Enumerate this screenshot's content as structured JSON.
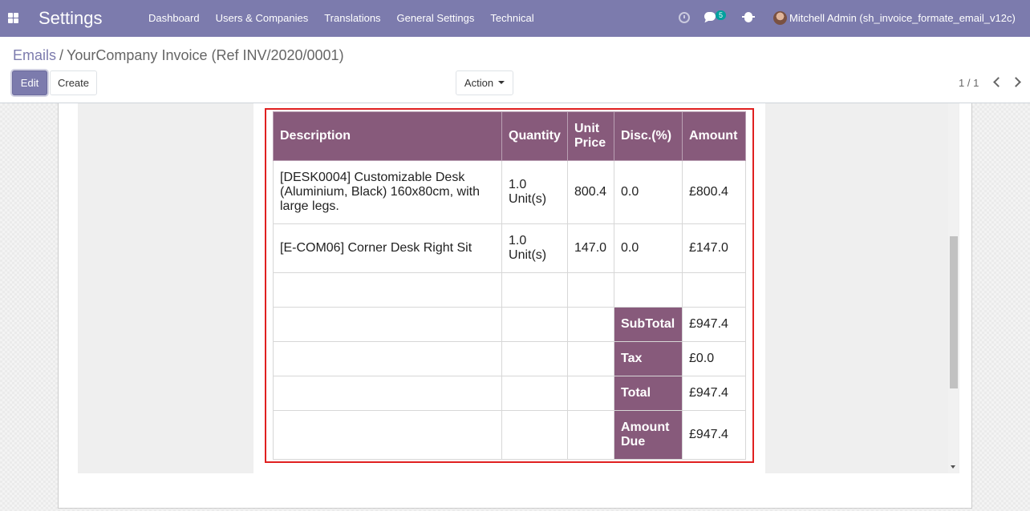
{
  "navbar": {
    "app_title": "Settings",
    "menu": [
      "Dashboard",
      "Users & Companies",
      "Translations",
      "General Settings",
      "Technical"
    ],
    "messages_count": "5",
    "user": "Mitchell Admin (sh_invoice_formate_email_v12c)",
    "color": "#7c7bad"
  },
  "breadcrumb": {
    "parent": "Emails",
    "separator": "/",
    "current": "YourCompany Invoice (Ref INV/2020/0001)"
  },
  "buttons": {
    "edit": "Edit",
    "create": "Create",
    "action": "Action"
  },
  "pager": {
    "value": "1 / 1"
  },
  "invoice": {
    "accent_color": "#875a7b",
    "highlight_color": "#e02020",
    "headers": {
      "description": "Description",
      "quantity": "Quantity",
      "unit_price": "Unit Price",
      "discount": "Disc.(%)",
      "amount": "Amount"
    },
    "lines": [
      {
        "description": "[DESK0004] Customizable Desk (Aluminium, Black) 160x80cm, with large legs.",
        "quantity": "1.0 Unit(s)",
        "unit_price": "800.4",
        "discount": "0.0",
        "amount": "£800.4"
      },
      {
        "description": "[E-COM06] Corner Desk Right Sit",
        "quantity": "1.0 Unit(s)",
        "unit_price": "147.0",
        "discount": "0.0",
        "amount": "£147.0"
      }
    ],
    "totals": {
      "subtotal_label": "SubTotal",
      "subtotal": "£947.4",
      "tax_label": "Tax",
      "tax": "£0.0",
      "total_label": "Total",
      "total": "£947.4",
      "amount_due_label": "Amount Due",
      "amount_due": "£947.4"
    }
  }
}
